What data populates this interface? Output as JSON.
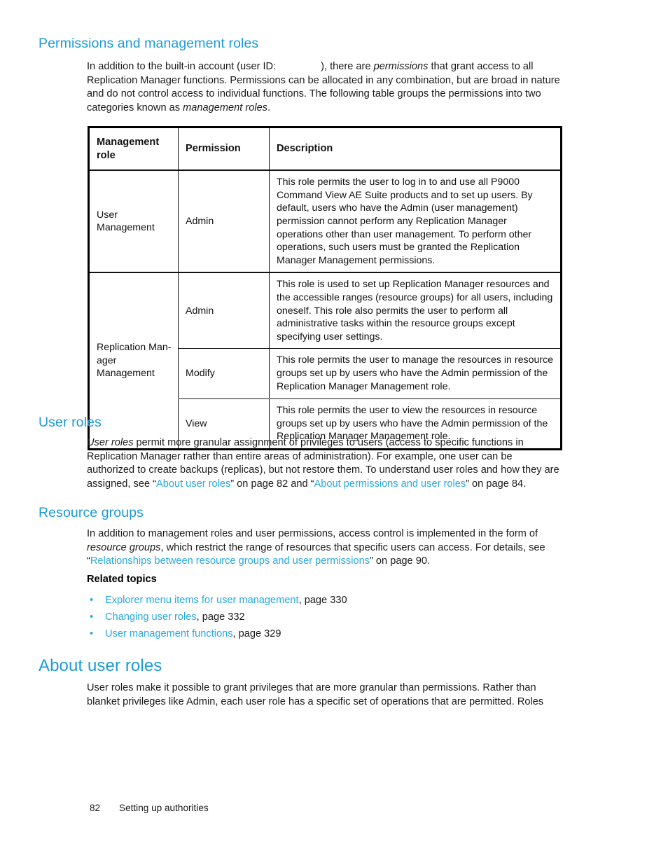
{
  "document": {
    "footer": {
      "page_number": "82",
      "section_title": "Setting up authorities"
    }
  },
  "sections": {
    "permissions": {
      "heading": "Permissions and management roles",
      "paragraph_part1": "In addition to the built-in account (user ID:",
      "paragraph_part2": "), there are ",
      "paragraph_em1": "permissions",
      "paragraph_part3": " that grant access to all Replication Manager functions. Permissions can be allocated in any combination, but are broad in nature and do not control access to individual functions. The following table groups the permissions into two categories known as ",
      "paragraph_em2": "management roles",
      "paragraph_part4": "."
    },
    "user_roles": {
      "heading": "User roles",
      "paragraph_em1": "User roles",
      "paragraph_part1": " permit more granular assignment of privileges to users (access to specific functions in Replication Manager rather than entire areas of administration). For example, one user can be authorized to create backups (replicas), but not restore them. To understand user roles and how they are assigned, see “",
      "link1": "About user roles",
      "paragraph_part2": "” on page 82 and “",
      "link2": "About permissions and user roles",
      "paragraph_part3": "” on page 84."
    },
    "resource_groups": {
      "heading": "Resource groups",
      "paragraph_part1": "In addition to management roles and user permissions, access control is implemented in the form of ",
      "paragraph_em1": "resource groups",
      "paragraph_part2": ", which restrict the range of resources that specific users can access. For details, see “",
      "link1": "Relationships between resource groups and user permissions",
      "paragraph_part3": "” on page 90.",
      "related_topics_heading": "Related topics",
      "related_topics": [
        {
          "bullet": "•",
          "link": "Explorer menu items for user management",
          "suffix": ", page 330"
        },
        {
          "bullet": "•",
          "link": "Changing user roles",
          "suffix": ", page 332"
        },
        {
          "bullet": "•",
          "link": "User management functions",
          "suffix": ", page 329"
        }
      ]
    },
    "about_user_roles": {
      "heading": "About user roles",
      "paragraph": "User roles make it possible to grant privileges that are more granular than permissions. Rather than blanket privileges like Admin, each user role has a specific set of operations that are permitted. Roles"
    }
  },
  "table": {
    "headers": {
      "col1_line1": "Management",
      "col1_line2": "role",
      "col2": "Permission",
      "col3": "Description"
    },
    "rows": [
      {
        "role": "User Management",
        "permission": "Admin",
        "description": "This role permits the user to log in to and use all P9000 Command View AE Suite products and to set up users. By default, users who have the Admin (user management) permission cannot perform any Replication Manager operations other than user management. To perform other operations, such users must be granted the Replication Manager Management permissions."
      },
      {
        "role": "Replication Man-­\nager Management",
        "role_line1": "Replication Man-",
        "role_line2": "ager Management",
        "permission": "Admin",
        "description": "This role is used to set up Replication Manager resources and the accessible ranges (resource groups) for all users, including oneself. This role also permits the user to perform all administrative tasks within the resource groups except specifying user settings."
      },
      {
        "permission": "Modify",
        "description": "This role permits the user to manage the resources in resource groups set up by users who have the Admin permission of the Replication Manager Management role."
      },
      {
        "permission": "View",
        "description": "This role permits the user to view the resources in resource groups set up by users who have the Admin permission of the Replication Manager Management role."
      }
    ]
  },
  "colors": {
    "heading_blue": "#1b9ad6",
    "link_blue": "#29a8e0",
    "text_black": "#1a1a1a"
  }
}
